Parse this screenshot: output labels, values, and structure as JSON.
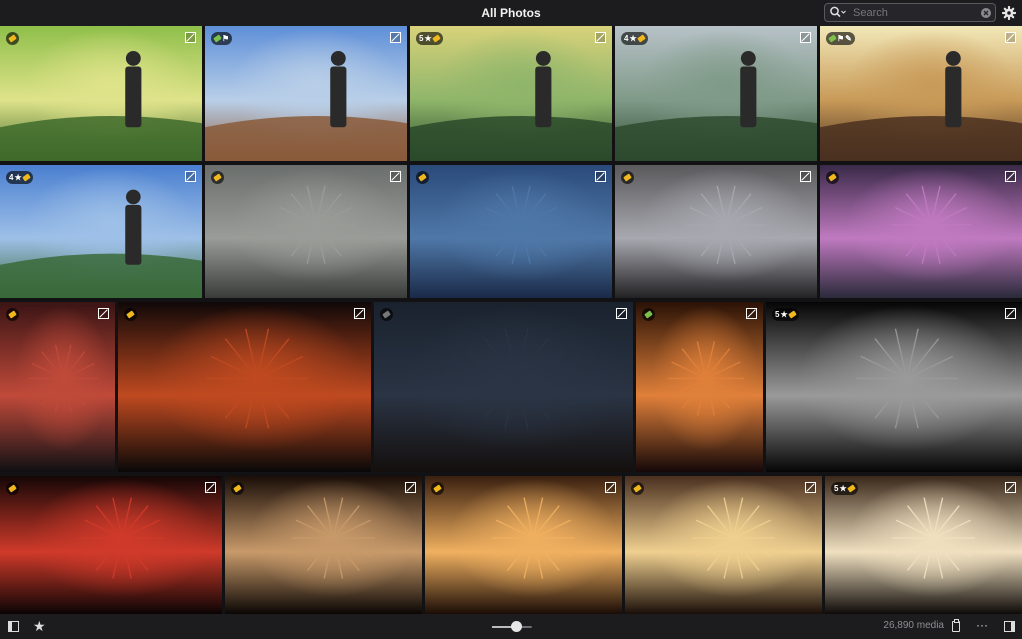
{
  "window": {
    "title": "All Photos"
  },
  "search": {
    "placeholder": "Search",
    "value": ""
  },
  "toolbar_icons": [
    "search-icon",
    "chevron-down-icon",
    "clear-icon",
    "gear-icon"
  ],
  "grid": {
    "rows": [
      {
        "tiles": [
          {
            "subject": "hiker-green-backpack-valley",
            "colors": [
              "#8fbf4a",
              "#dfe38a",
              "#3e6a2a"
            ],
            "badge": {
              "text": "",
              "tags": [
                "yellow"
              ]
            }
          },
          {
            "subject": "hiker-on-rocky-hill-blue-sky",
            "colors": [
              "#5e8fd8",
              "#b9cfe8",
              "#8a5a3a"
            ],
            "badge": {
              "text": "",
              "tags": [
                "green",
                "flag"
              ]
            }
          },
          {
            "subject": "hiker-red-jacket-sunrise",
            "colors": [
              "#d8d27a",
              "#8fb56a",
              "#2a4a2a"
            ],
            "badge": {
              "text": "5",
              "star": true,
              "tags": [
                "yellow"
              ]
            }
          },
          {
            "subject": "hiker-red-jacket-misty-mountains",
            "colors": [
              "#b8c2c8",
              "#7f9a88",
              "#2e4a2e"
            ],
            "badge": {
              "text": "4",
              "star": true,
              "tags": [
                "yellow"
              ]
            }
          },
          {
            "subject": "hiker-arms-raised-sunset",
            "colors": [
              "#f2e8b8",
              "#c89a58",
              "#4a3020"
            ],
            "badge": {
              "text": "",
              "tags": [
                "green",
                "flag",
                "pen"
              ]
            }
          }
        ]
      },
      {
        "tiles": [
          {
            "subject": "hiker-blue-backpack-mountains",
            "colors": [
              "#4a7fd0",
              "#9ec0e8",
              "#3a6a3a"
            ],
            "badge": {
              "text": "4",
              "star": true,
              "tags": [
                "yellow"
              ]
            }
          },
          {
            "subject": "woman-holding-sparkler",
            "colors": [
              "#6a6e6c",
              "#9a9c98",
              "#3a3c3a"
            ],
            "badge": {
              "text": "",
              "tags": [
                "yellow"
              ]
            }
          },
          {
            "subject": "hand-with-sparkler-blue",
            "colors": [
              "#2a4a7a",
              "#4f78a8",
              "#1a2a48"
            ],
            "badge": {
              "text": "",
              "tags": [
                "yellow"
              ]
            }
          },
          {
            "subject": "fireworks-over-trees",
            "colors": [
              "#5a5a5c",
              "#a8a8b0",
              "#222224"
            ],
            "badge": {
              "text": "",
              "tags": [
                "yellow"
              ]
            }
          },
          {
            "subject": "pink-fireworks-city-skyline",
            "colors": [
              "#3a2a48",
              "#c07ac0",
              "#2a2a3a"
            ],
            "badge": {
              "text": "",
              "tags": [
                "yellow"
              ]
            }
          }
        ]
      },
      {
        "tiles": [
          {
            "subject": "fireworks-space-needle",
            "colors": [
              "#3a1414",
              "#c04a3a",
              "#101014"
            ],
            "badge": {
              "text": "",
              "tags": [
                "yellow"
              ]
            }
          },
          {
            "subject": "sparkler-light-trail-night",
            "colors": [
              "#100808",
              "#c04a20",
              "#080808"
            ],
            "badge": {
              "text": "",
              "tags": [
                "yellow"
              ]
            }
          },
          {
            "subject": "single-firework-over-hills",
            "colors": [
              "#1a222e",
              "#2a3444",
              "#140f0d"
            ],
            "badge": {
              "text": "",
              "tags": [
                "gray"
              ]
            }
          },
          {
            "subject": "orange-fireworks-burst",
            "colors": [
              "#2a1206",
              "#e0803a",
              "#140808"
            ],
            "badge": {
              "text": "",
              "tags": [
                "green"
              ]
            }
          },
          {
            "subject": "white-fireworks-black-sky",
            "colors": [
              "#050505",
              "#9a9a9a",
              "#050505"
            ],
            "badge": {
              "text": "5",
              "star": true,
              "tags": [
                "yellow"
              ]
            }
          }
        ]
      },
      {
        "tiles": [
          {
            "subject": "red-fireworks-pair",
            "colors": [
              "#140606",
              "#d03a2a",
              "#0a0404"
            ],
            "badge": {
              "text": "",
              "tags": [
                "yellow"
              ]
            }
          },
          {
            "subject": "crowd-watching-fireworks",
            "colors": [
              "#1a0e08",
              "#c89a6a",
              "#0a0604"
            ],
            "badge": {
              "text": "",
              "tags": [
                "yellow"
              ]
            }
          },
          {
            "subject": "golden-fireworks-show",
            "colors": [
              "#3a2010",
              "#f0b060",
              "#1a0c06"
            ],
            "badge": {
              "text": "",
              "tags": [
                "yellow"
              ]
            }
          },
          {
            "subject": "golden-fireworks-smoke",
            "colors": [
              "#4a3020",
              "#f0d090",
              "#1a0e08"
            ],
            "badge": {
              "text": "",
              "tags": [
                "yellow"
              ]
            }
          },
          {
            "subject": "fireworks-over-crowd",
            "colors": [
              "#3a281a",
              "#f0e0c0",
              "#0e0a08"
            ],
            "badge": {
              "text": "5",
              "star": true,
              "tags": [
                "yellow"
              ]
            }
          }
        ]
      }
    ]
  },
  "footer": {
    "media_count": "26,890 media",
    "zoom_level": 0.6,
    "icons": [
      "sidebar-toggle-icon",
      "star-icon",
      "zoom-slider",
      "clipboard-icon",
      "more-icon",
      "info-panel-icon"
    ]
  }
}
